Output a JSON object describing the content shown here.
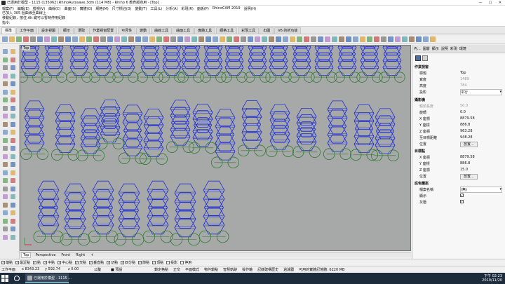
{
  "window": {
    "title": "已運用於模型 - 1115 (135062) RhinoAutosave.3dm (114 MB) - Rhino 6 教育版商用 - [Top]",
    "buttons": [
      "—",
      "□",
      "✕"
    ]
  },
  "menu": [
    "檔案(F)",
    "編輯(E)",
    "檢視(V)",
    "曲線(C)",
    "曲面(S)",
    "實體(O)",
    "網格(M)",
    "尺寸標註(D)",
    "變動(T)",
    "工具(L)",
    "分析(A)",
    "彩現(R)",
    "面板(P)",
    "RhinoCAM 2019",
    "說明(H)"
  ],
  "command": {
    "history1": "已加入 305 個曲線至曲線上",
    "history2": "移動紀錄，按住 Alt 鍵可以暫時停用紀錄",
    "prompt": "指令:",
    "value": ""
  },
  "tabs": [
    "標準",
    "工作平面",
    "設定視圖",
    "顯示",
    "選取",
    "作業視窗配置",
    "可見性",
    "變動",
    "曲線工具",
    "曲面工具",
    "實體工具",
    "網格工具",
    "彩現工具",
    "出圖",
    "V6 的新功能"
  ],
  "active_tab": 0,
  "viewport": {
    "label": "Top"
  },
  "view_tabs": [
    "Top",
    "Perspective",
    "Front",
    "Right",
    "+"
  ],
  "active_view": 0,
  "osnaps": [
    {
      "label": "端點",
      "checked": true
    },
    {
      "label": "最近點",
      "checked": true
    },
    {
      "label": "點",
      "checked": true
    },
    {
      "label": "中點",
      "checked": true
    },
    {
      "label": "中心點",
      "checked": true
    },
    {
      "label": "交點",
      "checked": true
    },
    {
      "label": "垂直點",
      "checked": true
    },
    {
      "label": "切點",
      "checked": true
    },
    {
      "label": "四分點",
      "checked": true
    },
    {
      "label": "節點",
      "checked": true
    },
    {
      "label": "頂點",
      "checked": true
    },
    {
      "label": "投影",
      "checked": false
    },
    {
      "label": "停用",
      "checked": false
    }
  ],
  "status": {
    "cplane": "工作平面",
    "x": "x 8343.23",
    "y": "y 592.74",
    "z": "z 0.00",
    "unit": "公釐",
    "layer": "■ 預設",
    "toggles": [
      "鎖定格點",
      "正交",
      "平面模式",
      "物件鎖點",
      "智慧軌跡",
      "操作軸",
      "記錄建構歷史",
      "過濾器",
      "可用的實體記憶體: 6220 MB"
    ]
  },
  "taskbar": {
    "app_label": "已運用於模型 - 1115 ...",
    "time": "下午 02:23",
    "date": "2019/11/20"
  },
  "properties": {
    "tabs": [
      "內...",
      "圖層",
      "顯示",
      "說明",
      "彩現",
      "環境"
    ],
    "section_view": "作業視窗",
    "title_label": "標題",
    "title_value": "Top",
    "width_label": "寬度",
    "width_value": "1489",
    "height_label": "高度",
    "height_value": "784",
    "projection_label": "投影",
    "projection_value": "平行",
    "section_camera": "攝影機",
    "lens_label": "鏡頭長度",
    "lens_value": "50.0",
    "rotation_label": "旋轉",
    "rotation_value": "0.0",
    "cx_label": "X 座標",
    "cx_value": "8879.58",
    "cy_label": "Y 座標",
    "cy_value": "886.8",
    "cz_label": "Z 座標",
    "cz_value": "963.28",
    "dist_label": "至目標距離",
    "dist_value": "948.28",
    "loc_label": "位置",
    "loc_button": "放置...",
    "section_target": "目標點",
    "tx_label": "X 座標",
    "tx_value": "8879.58",
    "ty_label": "Y 座標",
    "ty_value": "886.8",
    "tz_label": "Z 座標",
    "tz_value": "15.0",
    "tloc_label": "位置",
    "tloc_button": "放置...",
    "section_wallpaper": "底色圖案",
    "file_label": "檔案名稱",
    "file_value": "(無)",
    "show_label": "顯示",
    "gray_label": "灰階"
  },
  "colors": {
    "viewport_bg": "#a7a8a8",
    "hex_curve": "#1f2fd6",
    "circle_curve": "#2e7d32",
    "taskbar": "#1d2c3d"
  }
}
